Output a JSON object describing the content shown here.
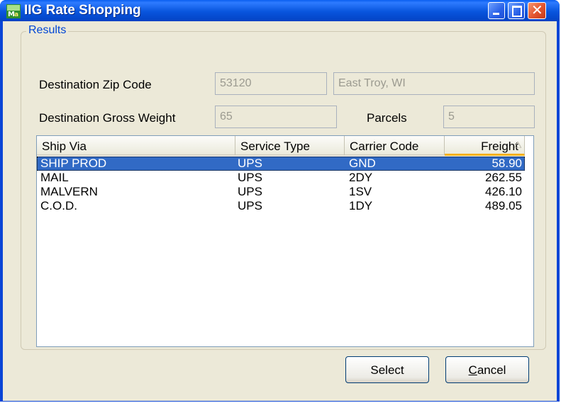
{
  "window": {
    "title": "IIG Rate Shopping"
  },
  "group": {
    "label": "Results"
  },
  "fields": {
    "destination_zip_label": "Destination Zip Code",
    "destination_zip_value": "53120",
    "city_state_value": "East Troy, WI",
    "gross_weight_label": "Destination Gross Weight",
    "gross_weight_value": "65",
    "parcels_label": "Parcels",
    "parcels_value": "5"
  },
  "table": {
    "columns": [
      "Ship Via",
      "Service Type",
      "Carrier Code",
      "Freight"
    ],
    "sort_column": "Freight",
    "rows": [
      {
        "ship_via": "SHIP PROD",
        "service_type": "UPS",
        "carrier_code": "GND",
        "freight": "58.90",
        "selected": true
      },
      {
        "ship_via": "MAIL",
        "service_type": "UPS",
        "carrier_code": "2DY",
        "freight": "262.55",
        "selected": false
      },
      {
        "ship_via": "MALVERN",
        "service_type": "UPS",
        "carrier_code": "1SV",
        "freight": "426.10",
        "selected": false
      },
      {
        "ship_via": "C.O.D.",
        "service_type": "UPS",
        "carrier_code": "1DY",
        "freight": "489.05",
        "selected": false
      }
    ]
  },
  "buttons": {
    "select_label": "Select",
    "cancel_label": "Cancel",
    "cancel_access_key": "C",
    "cancel_rest": "ancel"
  },
  "icons": {
    "app": "app-icon",
    "minimize": "minimize-icon",
    "maximize": "maximize-icon",
    "close": "close-icon",
    "sort": "sort-ascending-icon"
  },
  "colors": {
    "title_bar": "#0855dd",
    "selection": "#316ac5",
    "group_label": "#0046d5",
    "close_button": "#e2552f"
  }
}
